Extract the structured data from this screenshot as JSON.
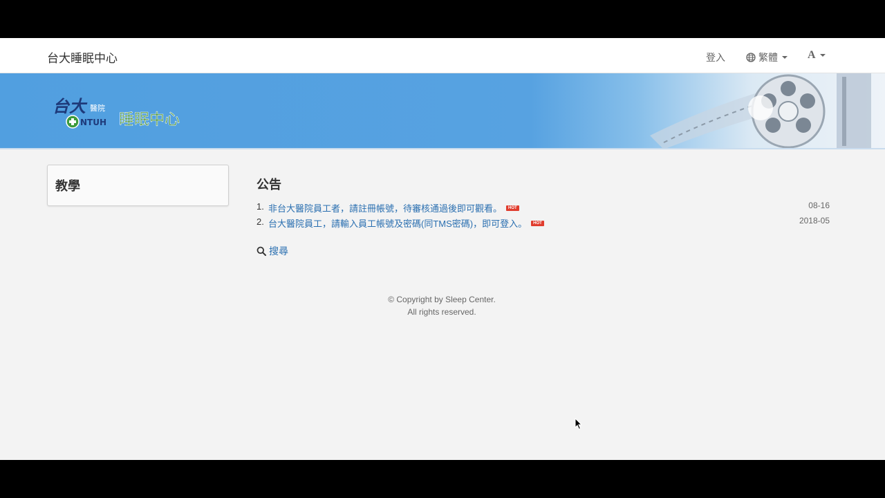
{
  "navbar": {
    "brand": "台大睡眠中心",
    "login": "登入",
    "language": "繁體",
    "font_size": "A"
  },
  "banner": {
    "logo_text": "睡眠中心",
    "logo_mark": "台大醫院 NTUH"
  },
  "sidebar": {
    "title": "教學"
  },
  "main": {
    "title": "公告",
    "announcements": [
      {
        "num": "1.",
        "text": "非台大醫院員工者，請註冊帳號，待審核通過後即可觀看。",
        "badge": "HOT",
        "date": "08-16"
      },
      {
        "num": "2.",
        "text": "台大醫院員工，請輸入員工帳號及密碼(同TMS密碼)，即可登入。",
        "badge": "HOT",
        "date": "2018-05"
      }
    ],
    "search_label": "搜尋"
  },
  "footer": {
    "line1": "© Copyright by Sleep Center.",
    "line2": "All rights reserved."
  },
  "colors": {
    "link": "#2a6fb0",
    "banner_blue": "#519fe0",
    "hot_badge": "#e03c2d"
  }
}
